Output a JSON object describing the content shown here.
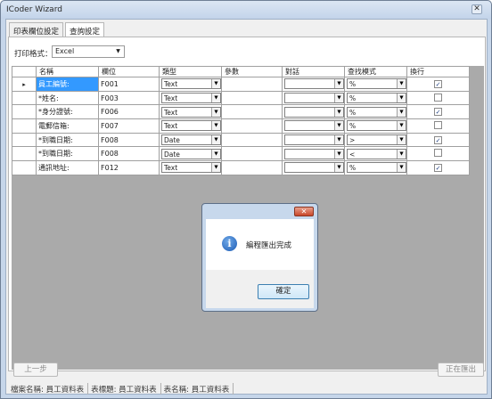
{
  "window": {
    "title": "ICoder Wizard",
    "close_glyph": "✕"
  },
  "tabs": [
    {
      "label": "印表欄位設定",
      "active": false
    },
    {
      "label": "查詢設定",
      "active": true
    }
  ],
  "print_format": {
    "label": "打印格式：",
    "value": "Excel"
  },
  "grid": {
    "columns": [
      "名稱",
      "欄位",
      "類型",
      "參數",
      "對話",
      "查找模式",
      "換行"
    ],
    "current_row_marker": "▸",
    "rows": [
      {
        "name": "員工編號:",
        "field": "F001",
        "type": "Text",
        "param": "",
        "dialog": "",
        "mode": "%",
        "wrap": true,
        "selected": true
      },
      {
        "name": "*姓名:",
        "field": "F003",
        "type": "Text",
        "param": "",
        "dialog": "",
        "mode": "%",
        "wrap": false,
        "selected": false
      },
      {
        "name": "*身分證號:",
        "field": "F006",
        "type": "Text",
        "param": "",
        "dialog": "",
        "mode": "%",
        "wrap": true,
        "selected": false
      },
      {
        "name": "電郵信箱:",
        "field": "F007",
        "type": "Text",
        "param": "",
        "dialog": "",
        "mode": "%",
        "wrap": false,
        "selected": false
      },
      {
        "name": "*到職日期:",
        "field": "F008",
        "type": "Date",
        "param": "",
        "dialog": "",
        "mode": ">",
        "wrap": true,
        "selected": false
      },
      {
        "name": "*到職日期:",
        "field": "F008",
        "type": "Date",
        "param": "",
        "dialog": "",
        "mode": "<",
        "wrap": false,
        "selected": false
      },
      {
        "name": "通訊地址:",
        "field": "F012",
        "type": "Text",
        "param": "",
        "dialog": "",
        "mode": "%",
        "wrap": true,
        "selected": false
      }
    ]
  },
  "dialog": {
    "message": "編程匯出完成",
    "ok_label": "確定",
    "close_glyph": "✕",
    "icon_glyph": "i"
  },
  "buttons": {
    "prev_label": "上一步",
    "exporting_label": "正在匯出"
  },
  "status": {
    "file_name": "檔案名稱: 員工資料表",
    "table_title": "表標題: 員工資料表",
    "table_name": "表名稱: 員工資料表"
  },
  "icons": {
    "dropdown": "chevron-down-icon",
    "check": "check-icon",
    "info": "info-icon"
  }
}
